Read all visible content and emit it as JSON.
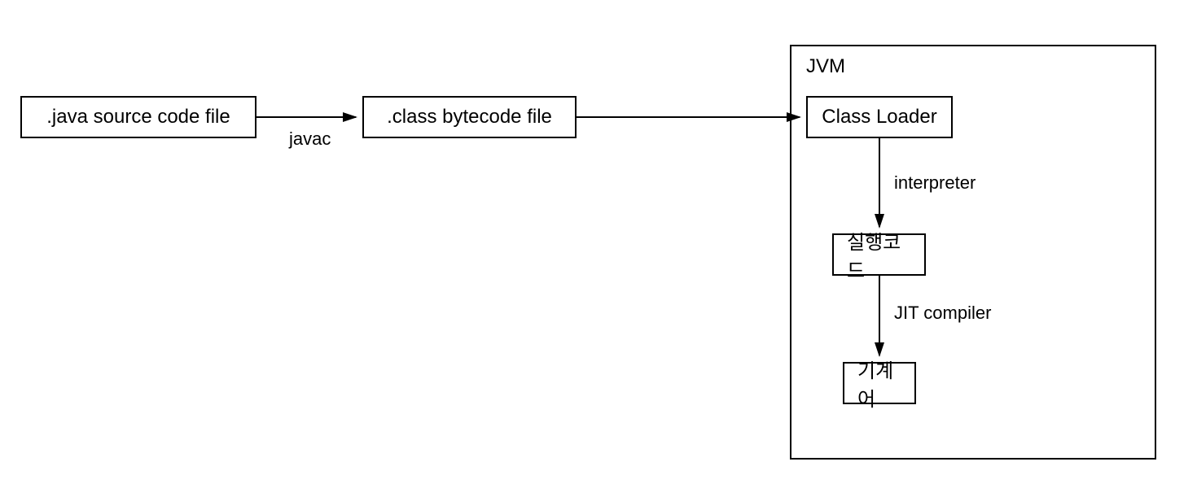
{
  "nodes": {
    "source": ".java source code file",
    "bytecode": ".class bytecode file",
    "classloader": "Class Loader",
    "execcode": "실행코드",
    "machinecode": "기계어"
  },
  "edges": {
    "javac": "javac",
    "interpreter": "interpreter",
    "jit": "JIT compiler"
  },
  "container": {
    "jvm": "JVM"
  }
}
